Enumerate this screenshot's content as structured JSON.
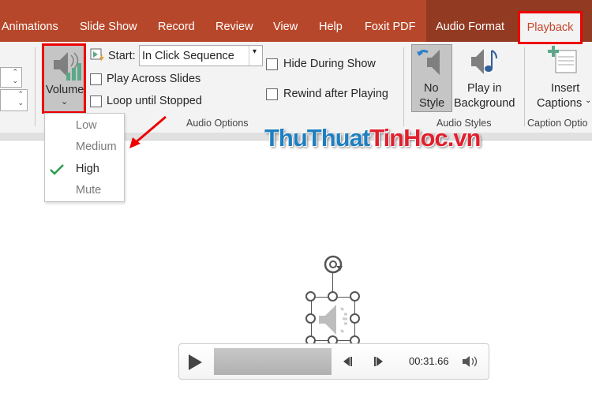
{
  "ribbon_tabs": [
    "Animations",
    "Slide Show",
    "Record",
    "Review",
    "View",
    "Help",
    "Foxit PDF",
    "Audio Format"
  ],
  "active_tab": "Playback",
  "volume": {
    "label": "Volume",
    "menu": [
      "Low",
      "Medium",
      "High",
      "Mute"
    ],
    "selected": "High"
  },
  "audio_options": {
    "start_label": "Start:",
    "start_value": "In Click Sequence",
    "play_across_slides": {
      "label": "Play Across Slides",
      "checked": false
    },
    "loop_until_stopped": {
      "label": "Loop until Stopped",
      "checked": false
    },
    "hide_during_show": {
      "label": "Hide During Show",
      "checked": false
    },
    "rewind_after_playing": {
      "label": "Rewind after Playing",
      "checked": false
    },
    "group_label": "Audio Options"
  },
  "audio_styles": {
    "no_style_1": "No",
    "no_style_2": "Style",
    "play_bg_1": "Play in",
    "play_bg_2": "Background",
    "group_label": "Audio Styles"
  },
  "captions": {
    "insert_1": "Insert",
    "insert_2": "Captions",
    "group_label": "Caption Optio"
  },
  "watermark": {
    "part1": "ThuThuat",
    "part2": "TinHoc",
    "part3": ".vn"
  },
  "player": {
    "time": "00:31.66"
  },
  "colors": {
    "ribbon": "#b7472a",
    "contextual": "#923a22",
    "highlight": "#e00000",
    "check": "#2e9b4f"
  }
}
